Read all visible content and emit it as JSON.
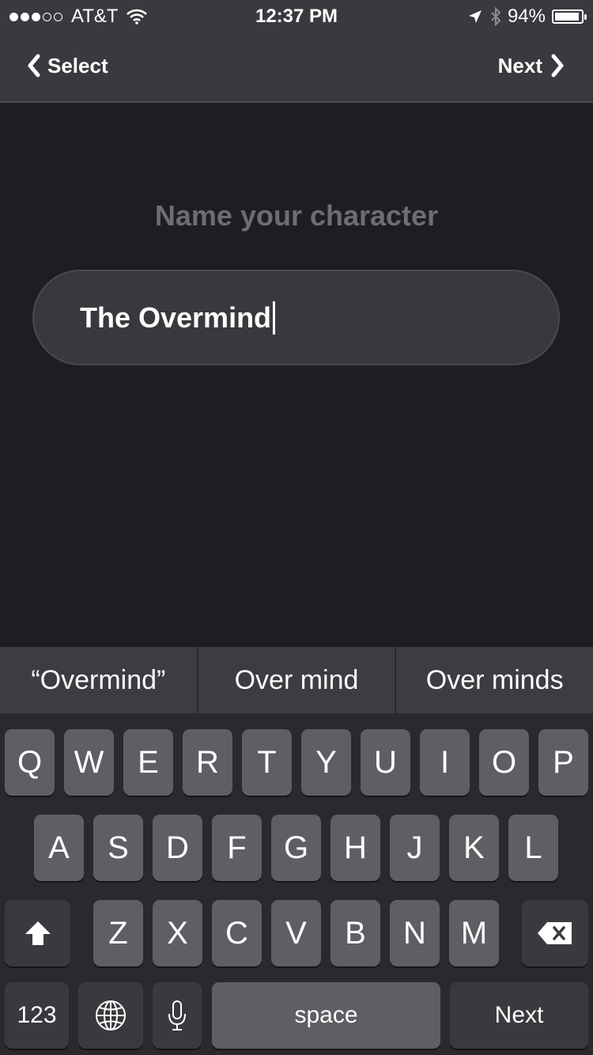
{
  "status_bar": {
    "signal_bars_filled": 3,
    "signal_bars_total": 5,
    "carrier": "AT&T",
    "wifi_icon": "wifi-icon",
    "time": "12:37 PM",
    "location_icon": "location-arrow-icon",
    "bluetooth_icon": "bluetooth-icon",
    "battery_percent": "94%",
    "battery_level": 0.94
  },
  "nav": {
    "back_label": "Select",
    "next_label": "Next"
  },
  "main": {
    "prompt": "Name your character",
    "name_value": "The Overmind"
  },
  "suggestions": [
    "“Overmind”",
    "Over mind",
    "Over minds"
  ],
  "keyboard": {
    "row1": [
      "Q",
      "W",
      "E",
      "R",
      "T",
      "Y",
      "U",
      "I",
      "O",
      "P"
    ],
    "row2": [
      "A",
      "S",
      "D",
      "F",
      "G",
      "H",
      "J",
      "K",
      "L"
    ],
    "row3": [
      "Z",
      "X",
      "C",
      "V",
      "B",
      "N",
      "M"
    ],
    "numbers_label": "123",
    "space_label": "space",
    "return_label": "Next",
    "shift_icon": "shift-icon",
    "delete_icon": "backspace-icon",
    "globe_icon": "globe-icon",
    "mic_icon": "microphone-icon"
  },
  "colors": {
    "background": "#1e1d21",
    "bar": "#3a393e",
    "key": "#5f5e63",
    "key_dark": "#3a393d",
    "prompt_text": "#6e6d72"
  }
}
